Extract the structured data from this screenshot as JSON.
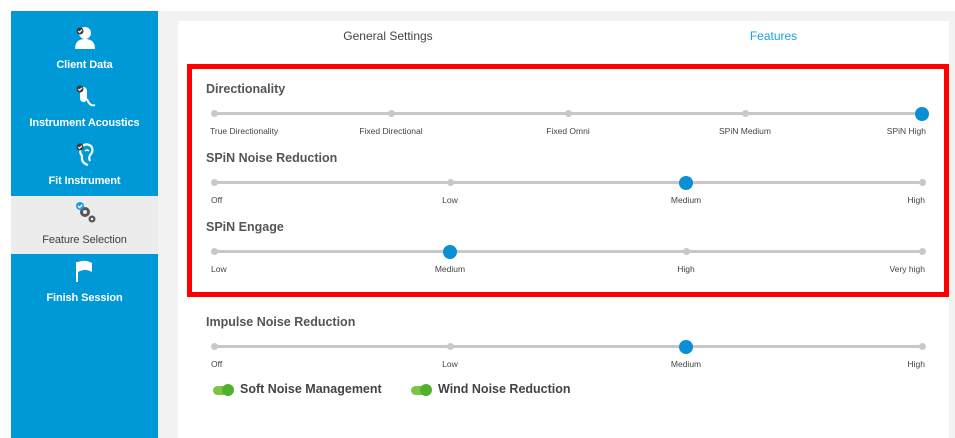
{
  "sidebar": {
    "items": [
      {
        "label": "Client Data",
        "icon": "person-check-icon"
      },
      {
        "label": "Instrument Acoustics",
        "icon": "hearing-aid-check-icon"
      },
      {
        "label": "Fit Instrument",
        "icon": "ear-check-icon"
      },
      {
        "label": "Feature Selection",
        "icon": "gears-check-icon",
        "active": true
      },
      {
        "label": "Finish Session",
        "icon": "flag-icon"
      }
    ]
  },
  "tabs": {
    "general": "General Settings",
    "features": "Features",
    "active": "features"
  },
  "sliders": {
    "directionality": {
      "title": "Directionality",
      "stops": [
        "True Directionality",
        "Fixed Directional",
        "Fixed Omni",
        "SPiN Medium",
        "SPiN High"
      ],
      "selected": "SPiN High"
    },
    "noise_reduction": {
      "title": "SPiN Noise Reduction",
      "stops": [
        "Off",
        "Low",
        "Medium",
        "High"
      ],
      "selected": "Medium"
    },
    "engage": {
      "title": "SPiN Engage",
      "stops": [
        "Low",
        "Medium",
        "High",
        "Very high"
      ],
      "selected": "Medium"
    },
    "impulse": {
      "title": "Impulse Noise Reduction",
      "stops": [
        "Off",
        "Low",
        "Medium",
        "High"
      ],
      "selected": "Medium"
    }
  },
  "toggles": [
    {
      "label": "Soft Noise Management",
      "on": true
    },
    {
      "label": "Wind Noise Reduction",
      "on": true
    }
  ],
  "colors": {
    "sidebar_bg": "#0099d8",
    "accent": "#0a8ed6",
    "highlight_border": "#ff0000",
    "toggle_on": "#7cc443"
  }
}
